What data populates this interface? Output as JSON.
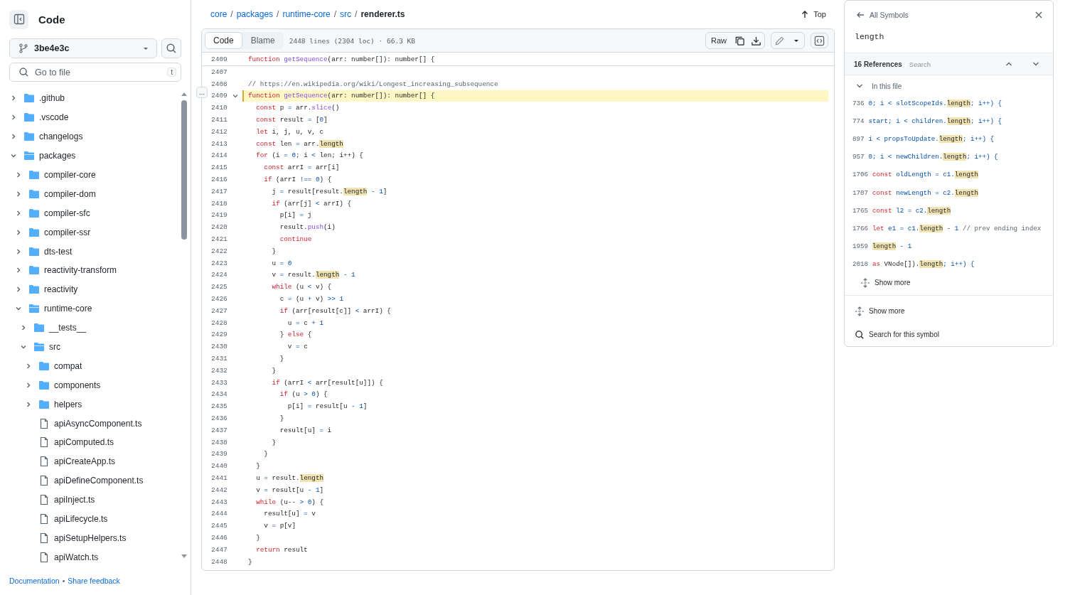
{
  "sidebar": {
    "title": "Code",
    "branch": "3be4e3c",
    "search": {
      "placeholder": "Go to file",
      "shortcut": "t"
    },
    "tree": [
      {
        "kind": "folder",
        "name": ".github",
        "expanded": false
      },
      {
        "kind": "folder",
        "name": ".vscode",
        "expanded": false
      },
      {
        "kind": "folder",
        "name": "changelogs",
        "expanded": false
      },
      {
        "kind": "folder",
        "name": "packages",
        "expanded": true,
        "children": [
          {
            "kind": "folder",
            "name": "compiler-core",
            "expanded": false
          },
          {
            "kind": "folder",
            "name": "compiler-dom",
            "expanded": false
          },
          {
            "kind": "folder",
            "name": "compiler-sfc",
            "expanded": false
          },
          {
            "kind": "folder",
            "name": "compiler-ssr",
            "expanded": false
          },
          {
            "kind": "folder",
            "name": "dts-test",
            "expanded": false
          },
          {
            "kind": "folder",
            "name": "reactivity-transform",
            "expanded": false
          },
          {
            "kind": "folder",
            "name": "reactivity",
            "expanded": false
          },
          {
            "kind": "folder",
            "name": "runtime-core",
            "expanded": true,
            "children": [
              {
                "kind": "folder",
                "name": "__tests__",
                "expanded": false
              },
              {
                "kind": "folder",
                "name": "src",
                "expanded": true,
                "children": [
                  {
                    "kind": "folder",
                    "name": "compat",
                    "expanded": false
                  },
                  {
                    "kind": "folder",
                    "name": "components",
                    "expanded": false
                  },
                  {
                    "kind": "folder",
                    "name": "helpers",
                    "expanded": false
                  },
                  {
                    "kind": "file",
                    "name": "apiAsyncComponent.ts"
                  },
                  {
                    "kind": "file",
                    "name": "apiComputed.ts"
                  },
                  {
                    "kind": "file",
                    "name": "apiCreateApp.ts"
                  },
                  {
                    "kind": "file",
                    "name": "apiDefineComponent.ts"
                  },
                  {
                    "kind": "file",
                    "name": "apiInject.ts"
                  },
                  {
                    "kind": "file",
                    "name": "apiLifecycle.ts"
                  },
                  {
                    "kind": "file",
                    "name": "apiSetupHelpers.ts"
                  },
                  {
                    "kind": "file",
                    "name": "apiWatch.ts"
                  }
                ]
              }
            ]
          }
        ]
      }
    ],
    "footer": {
      "links": [
        "Documentation",
        "Share feedback"
      ],
      "separator": "•"
    }
  },
  "breadcrumb": {
    "parts": [
      "core",
      "packages",
      "runtime-core",
      "src"
    ],
    "separator": "/",
    "current": "renderer.ts",
    "top_link": "Top"
  },
  "toolbar": {
    "tabs": [
      {
        "label": "Code",
        "selected": true
      },
      {
        "label": "Blame",
        "selected": false
      }
    ],
    "file_info": "2448 lines (2304 loc) · 66.3 KB",
    "raw_button": "Raw"
  },
  "sticky_line": {
    "n": "2409",
    "tokens": [
      {
        "t": "function",
        "kind": "keyword"
      },
      {
        "t": " getSequence",
        "kind": "function"
      },
      {
        "t": "(arr: number[]): number[] {",
        "kind": "plain"
      }
    ]
  },
  "line_options": "…",
  "code_lines": [
    {
      "n": "2407",
      "selected": false
    },
    {
      "n": "2408",
      "selected": false,
      "tokens": [
        {
          "t": "// https://en.wikipedia.org/wiki/Longest_increasing_subsequence",
          "kind": "comment"
        }
      ]
    },
    {
      "n": "2409",
      "selected": true,
      "foldable": true,
      "tokens": [
        {
          "t": "function",
          "kind": "keyword"
        },
        {
          "t": " getSequence",
          "kind": "function"
        },
        {
          "t": "(arr: number[]): number[] {",
          "kind": "plain"
        }
      ]
    },
    {
      "n": "2410",
      "selected": false,
      "tokens": [
        {
          "t": "  const",
          "kind": "keyword"
        },
        {
          "t": " p",
          "kind": "plain"
        },
        {
          "t": " =",
          "kind": "constant"
        },
        {
          "t": " arr.",
          "kind": "plain"
        },
        {
          "t": "slice",
          "kind": "function"
        },
        {
          "t": "()",
          "kind": "plain"
        }
      ]
    },
    {
      "n": "2411",
      "selected": false,
      "tokens": [
        {
          "t": "  const",
          "kind": "keyword"
        },
        {
          "t": " result",
          "kind": "plain"
        },
        {
          "t": " =",
          "kind": "constant"
        },
        {
          "t": " [",
          "kind": "plain"
        },
        {
          "t": "0",
          "kind": "constant"
        },
        {
          "t": "]",
          "kind": "plain"
        }
      ]
    },
    {
      "n": "2412",
      "selected": false,
      "tokens": [
        {
          "t": "  let",
          "kind": "keyword"
        },
        {
          "t": " i, j, u, v, c",
          "kind": "plain"
        }
      ]
    },
    {
      "n": "2413",
      "selected": false,
      "tokens": [
        {
          "t": "  const",
          "kind": "keyword"
        },
        {
          "t": " len",
          "kind": "plain"
        },
        {
          "t": " =",
          "kind": "constant"
        },
        {
          "t": " arr.",
          "kind": "plain"
        },
        {
          "t": "length",
          "kind": "match"
        }
      ]
    },
    {
      "n": "2414",
      "selected": false,
      "tokens": [
        {
          "t": "  for",
          "kind": "keyword"
        },
        {
          "t": " (i",
          "kind": "plain"
        },
        {
          "t": " =",
          "kind": "constant"
        },
        {
          "t": " 0",
          "kind": "constant"
        },
        {
          "t": "; i",
          "kind": "plain"
        },
        {
          "t": " <",
          "kind": "constant"
        },
        {
          "t": " len; i++) {",
          "kind": "plain"
        }
      ]
    },
    {
      "n": "2415",
      "selected": false,
      "tokens": [
        {
          "t": "    const",
          "kind": "keyword"
        },
        {
          "t": " arrI",
          "kind": "plain"
        },
        {
          "t": " =",
          "kind": "constant"
        },
        {
          "t": " arr[i]",
          "kind": "plain"
        }
      ]
    },
    {
      "n": "2416",
      "selected": false,
      "tokens": [
        {
          "t": "    if",
          "kind": "keyword"
        },
        {
          "t": " (arrI",
          "kind": "plain"
        },
        {
          "t": " !==",
          "kind": "constant"
        },
        {
          "t": " 0",
          "kind": "constant"
        },
        {
          "t": ") {",
          "kind": "plain"
        }
      ]
    },
    {
      "n": "2417",
      "selected": false,
      "tokens": [
        {
          "t": "      j",
          "kind": "plain"
        },
        {
          "t": " =",
          "kind": "constant"
        },
        {
          "t": " result[result.",
          "kind": "plain"
        },
        {
          "t": "length",
          "kind": "match"
        },
        {
          "t": " -",
          "kind": "constant"
        },
        {
          "t": " 1",
          "kind": "constant"
        },
        {
          "t": "]",
          "kind": "plain"
        }
      ]
    },
    {
      "n": "2418",
      "selected": false,
      "tokens": [
        {
          "t": "      if",
          "kind": "keyword"
        },
        {
          "t": " (arr[j]",
          "kind": "plain"
        },
        {
          "t": " <",
          "kind": "constant"
        },
        {
          "t": " arrI) {",
          "kind": "plain"
        }
      ]
    },
    {
      "n": "2419",
      "selected": false,
      "tokens": [
        {
          "t": "        p[i]",
          "kind": "plain"
        },
        {
          "t": " =",
          "kind": "constant"
        },
        {
          "t": " j",
          "kind": "plain"
        }
      ]
    },
    {
      "n": "2420",
      "selected": false,
      "tokens": [
        {
          "t": "        result.",
          "kind": "plain"
        },
        {
          "t": "push",
          "kind": "function"
        },
        {
          "t": "(i)",
          "kind": "plain"
        }
      ]
    },
    {
      "n": "2421",
      "selected": false,
      "tokens": [
        {
          "t": "        continue",
          "kind": "keyword"
        }
      ]
    },
    {
      "n": "2422",
      "selected": false,
      "tokens": [
        {
          "t": "      }",
          "kind": "plain"
        }
      ]
    },
    {
      "n": "2423",
      "selected": false,
      "tokens": [
        {
          "t": "      u",
          "kind": "plain"
        },
        {
          "t": " =",
          "kind": "constant"
        },
        {
          "t": " 0",
          "kind": "constant"
        }
      ]
    },
    {
      "n": "2424",
      "selected": false,
      "tokens": [
        {
          "t": "      v",
          "kind": "plain"
        },
        {
          "t": " =",
          "kind": "constant"
        },
        {
          "t": " result.",
          "kind": "plain"
        },
        {
          "t": "length",
          "kind": "match"
        },
        {
          "t": " -",
          "kind": "constant"
        },
        {
          "t": " 1",
          "kind": "constant"
        }
      ]
    },
    {
      "n": "2425",
      "selected": false,
      "tokens": [
        {
          "t": "      while",
          "kind": "keyword"
        },
        {
          "t": " (u",
          "kind": "plain"
        },
        {
          "t": " <",
          "kind": "constant"
        },
        {
          "t": " v) {",
          "kind": "plain"
        }
      ]
    },
    {
      "n": "2426",
      "selected": false,
      "tokens": [
        {
          "t": "        c",
          "kind": "plain"
        },
        {
          "t": " =",
          "kind": "constant"
        },
        {
          "t": " (u",
          "kind": "plain"
        },
        {
          "t": " +",
          "kind": "constant"
        },
        {
          "t": " v)",
          "kind": "plain"
        },
        {
          "t": " >>",
          "kind": "constant"
        },
        {
          "t": " 1",
          "kind": "constant"
        }
      ]
    },
    {
      "n": "2427",
      "selected": false,
      "tokens": [
        {
          "t": "        if",
          "kind": "keyword"
        },
        {
          "t": " (arr[result[c]]",
          "kind": "plain"
        },
        {
          "t": " <",
          "kind": "constant"
        },
        {
          "t": " arrI) {",
          "kind": "plain"
        }
      ]
    },
    {
      "n": "2428",
      "selected": false,
      "tokens": [
        {
          "t": "          u",
          "kind": "plain"
        },
        {
          "t": " =",
          "kind": "constant"
        },
        {
          "t": " c",
          "kind": "plain"
        },
        {
          "t": " +",
          "kind": "constant"
        },
        {
          "t": " 1",
          "kind": "constant"
        }
      ]
    },
    {
      "n": "2429",
      "selected": false,
      "tokens": [
        {
          "t": "        }",
          "kind": "plain"
        },
        {
          "t": " else",
          "kind": "keyword"
        },
        {
          "t": " {",
          "kind": "plain"
        }
      ]
    },
    {
      "n": "2430",
      "selected": false,
      "tokens": [
        {
          "t": "          v",
          "kind": "plain"
        },
        {
          "t": " =",
          "kind": "constant"
        },
        {
          "t": " c",
          "kind": "plain"
        }
      ]
    },
    {
      "n": "2431",
      "selected": false,
      "tokens": [
        {
          "t": "        }",
          "kind": "plain"
        }
      ]
    },
    {
      "n": "2432",
      "selected": false,
      "tokens": [
        {
          "t": "      }",
          "kind": "plain"
        }
      ]
    },
    {
      "n": "2433",
      "selected": false,
      "tokens": [
        {
          "t": "      if",
          "kind": "keyword"
        },
        {
          "t": " (arrI",
          "kind": "plain"
        },
        {
          "t": " <",
          "kind": "constant"
        },
        {
          "t": " arr[result[u]]) {",
          "kind": "plain"
        }
      ]
    },
    {
      "n": "2434",
      "selected": false,
      "tokens": [
        {
          "t": "        if",
          "kind": "keyword"
        },
        {
          "t": " (u",
          "kind": "plain"
        },
        {
          "t": " >",
          "kind": "constant"
        },
        {
          "t": " 0",
          "kind": "constant"
        },
        {
          "t": ") {",
          "kind": "plain"
        }
      ]
    },
    {
      "n": "2435",
      "selected": false,
      "tokens": [
        {
          "t": "          p[i]",
          "kind": "plain"
        },
        {
          "t": " =",
          "kind": "constant"
        },
        {
          "t": " result[u",
          "kind": "plain"
        },
        {
          "t": " -",
          "kind": "constant"
        },
        {
          "t": " 1",
          "kind": "constant"
        },
        {
          "t": "]",
          "kind": "plain"
        }
      ]
    },
    {
      "n": "2436",
      "selected": false,
      "tokens": [
        {
          "t": "        }",
          "kind": "plain"
        }
      ]
    },
    {
      "n": "2437",
      "selected": false,
      "tokens": [
        {
          "t": "        result[u]",
          "kind": "plain"
        },
        {
          "t": " =",
          "kind": "constant"
        },
        {
          "t": " i",
          "kind": "plain"
        }
      ]
    },
    {
      "n": "2438",
      "selected": false,
      "tokens": [
        {
          "t": "      }",
          "kind": "plain"
        }
      ]
    },
    {
      "n": "2439",
      "selected": false,
      "tokens": [
        {
          "t": "    }",
          "kind": "plain"
        }
      ]
    },
    {
      "n": "2440",
      "selected": false,
      "tokens": [
        {
          "t": "  }",
          "kind": "plain"
        }
      ]
    },
    {
      "n": "2441",
      "selected": false,
      "tokens": [
        {
          "t": "  u",
          "kind": "plain"
        },
        {
          "t": " =",
          "kind": "constant"
        },
        {
          "t": " result.",
          "kind": "plain"
        },
        {
          "t": "length",
          "kind": "match"
        }
      ]
    },
    {
      "n": "2442",
      "selected": false,
      "tokens": [
        {
          "t": "  v",
          "kind": "plain"
        },
        {
          "t": " =",
          "kind": "constant"
        },
        {
          "t": " result[u",
          "kind": "plain"
        },
        {
          "t": " -",
          "kind": "constant"
        },
        {
          "t": " 1",
          "kind": "constant"
        },
        {
          "t": "]",
          "kind": "plain"
        }
      ]
    },
    {
      "n": "2443",
      "selected": false,
      "tokens": [
        {
          "t": "  while",
          "kind": "keyword"
        },
        {
          "t": " (u--",
          "kind": "plain"
        },
        {
          "t": " >",
          "kind": "constant"
        },
        {
          "t": " 0",
          "kind": "constant"
        },
        {
          "t": ") {",
          "kind": "plain"
        }
      ]
    },
    {
      "n": "2444",
      "selected": false,
      "tokens": [
        {
          "t": "    result[u]",
          "kind": "plain"
        },
        {
          "t": " =",
          "kind": "constant"
        },
        {
          "t": " v",
          "kind": "plain"
        }
      ]
    },
    {
      "n": "2445",
      "selected": false,
      "tokens": [
        {
          "t": "    v",
          "kind": "plain"
        },
        {
          "t": " =",
          "kind": "constant"
        },
        {
          "t": " p[v]",
          "kind": "plain"
        }
      ]
    },
    {
      "n": "2446",
      "selected": false,
      "tokens": [
        {
          "t": "  }",
          "kind": "plain"
        }
      ]
    },
    {
      "n": "2447",
      "selected": false,
      "tokens": [
        {
          "t": "  return",
          "kind": "keyword"
        },
        {
          "t": " result",
          "kind": "plain"
        }
      ]
    },
    {
      "n": "2448",
      "selected": false,
      "tokens": [
        {
          "t": "}",
          "kind": "plain"
        }
      ]
    }
  ],
  "symbols_panel": {
    "back_link": "All Symbols",
    "symbol": "length",
    "references_count": "16 References",
    "search_placeholder": "Search",
    "group_label": "In this file",
    "group_expanded": true,
    "references": [
      {
        "n": "736",
        "tokens": [
          {
            "t": "0; i < slotScopeIds.",
            "kind": "constant"
          },
          {
            "t": "length",
            "kind": "match"
          },
          {
            "t": "; i++) {",
            "kind": "constant"
          }
        ]
      },
      {
        "n": "774",
        "tokens": [
          {
            "t": "start; i < children.",
            "kind": "constant"
          },
          {
            "t": "length",
            "kind": "match"
          },
          {
            "t": "; i++) {",
            "kind": "constant"
          }
        ]
      },
      {
        "n": "897",
        "tokens": [
          {
            "t": "i < propsToUpdate.",
            "kind": "constant"
          },
          {
            "t": "length",
            "kind": "match"
          },
          {
            "t": "; i++) {",
            "kind": "constant"
          }
        ]
      },
      {
        "n": "957",
        "tokens": [
          {
            "t": "0; i < newChildren.",
            "kind": "constant"
          },
          {
            "t": "length",
            "kind": "match"
          },
          {
            "t": "; i++) {",
            "kind": "constant"
          }
        ]
      },
      {
        "n": "1706",
        "tokens": [
          {
            "t": "const",
            "kind": "keyword"
          },
          {
            "t": " oldLength = c1.",
            "kind": "constant"
          },
          {
            "t": "length",
            "kind": "match"
          }
        ]
      },
      {
        "n": "1707",
        "tokens": [
          {
            "t": "const",
            "kind": "keyword"
          },
          {
            "t": " newLength = c2.",
            "kind": "constant"
          },
          {
            "t": "length",
            "kind": "match"
          }
        ]
      },
      {
        "n": "1765",
        "tokens": [
          {
            "t": "const",
            "kind": "keyword"
          },
          {
            "t": " l2 = c2.",
            "kind": "constant"
          },
          {
            "t": "length",
            "kind": "match"
          }
        ]
      },
      {
        "n": "1766",
        "tokens": [
          {
            "t": "let",
            "kind": "keyword"
          },
          {
            "t": " e1 = c1.",
            "kind": "constant"
          },
          {
            "t": "length",
            "kind": "match"
          },
          {
            "t": " - 1",
            "kind": "constant"
          },
          {
            "t": " // prev ending index",
            "kind": "comment"
          }
        ]
      },
      {
        "n": "1959",
        "tokens": [
          {
            "t": "length",
            "kind": "match"
          },
          {
            "t": " - 1",
            "kind": "constant"
          }
        ]
      },
      {
        "n": "2018",
        "tokens": [
          {
            "t": "as",
            "kind": "keyword"
          },
          {
            "t": " VNode[]).",
            "kind": "plain"
          },
          {
            "t": "length",
            "kind": "match"
          },
          {
            "t": "; i++) {",
            "kind": "constant"
          }
        ]
      }
    ],
    "group_show_more": "Show more",
    "show_more": "Show more",
    "search_symbol": "Search for this symbol"
  }
}
